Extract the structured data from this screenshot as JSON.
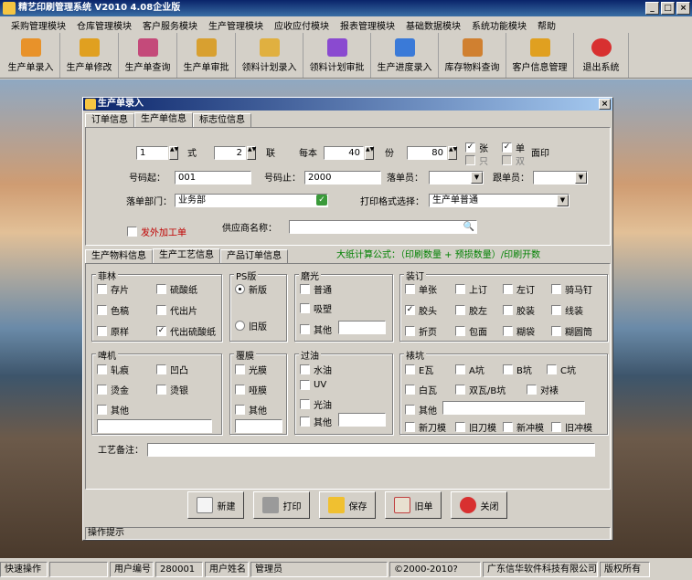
{
  "app": {
    "title": "精艺印刷管理系统   V2010   4.08企业版"
  },
  "menu": [
    "采购管理模块",
    "仓库管理模块",
    "客户服务模块",
    "生产管理模块",
    "应收应付模块",
    "报表管理模块",
    "基础数据模块",
    "系统功能模块",
    "帮助"
  ],
  "toolbar": [
    {
      "label": "生产单录入",
      "icon": "production-entry-icon",
      "color": "#e8922a"
    },
    {
      "label": "生产单修改",
      "icon": "production-edit-icon",
      "color": "#e0a020"
    },
    {
      "label": "生产单查询",
      "icon": "production-query-icon",
      "color": "#c44a7a"
    },
    {
      "label": "生产单审批",
      "icon": "production-approve-icon",
      "color": "#d8a030"
    },
    {
      "label": "领料计划录入",
      "icon": "material-plan-entry-icon",
      "color": "#e0b040"
    },
    {
      "label": "领料计划审批",
      "icon": "material-plan-approve-icon",
      "color": "#8a4ad0"
    },
    {
      "label": "生产进度录入",
      "icon": "progress-entry-icon",
      "color": "#3a7ad8"
    },
    {
      "label": "库存物料查询",
      "icon": "inventory-query-icon",
      "color": "#d08030"
    },
    {
      "label": "客户信息管理",
      "icon": "customer-info-icon",
      "color": "#e0a020"
    },
    {
      "label": "退出系统",
      "icon": "exit-icon",
      "color": "#d83030"
    }
  ],
  "status": {
    "quick_ops": "快速操作",
    "user_no_label": "用户编号",
    "user_no": "280001",
    "user_name_label": "用户姓名",
    "user_name": "管理员",
    "copyright": "©2000-2010?",
    "company": "广东信华软件科技有限公司",
    "rights": "版权所有"
  },
  "child": {
    "title": "生产单录入",
    "tabs": [
      "订单信息",
      "生产单信息",
      "标志位信息"
    ],
    "row1": {
      "v1": "1",
      "l1": "式",
      "v2": "2",
      "l2": "联",
      "l3": "每本",
      "v3": "40",
      "l4": "份",
      "v4": "80",
      "cb_zhang": "张",
      "cb_zhi": "只",
      "cb_dan": "单",
      "cb_shuang": "双",
      "l5": "面印"
    },
    "row2": {
      "start_label": "号码起：",
      "start": "001",
      "end_label": "号码止：",
      "end": "2000",
      "order_person_label": "落单员：",
      "follow_label": "跟单员："
    },
    "row3": {
      "dept_label": "落单部门：",
      "dept": "业务部",
      "print_fmt_label": "打印格式选择：",
      "print_fmt": "生产单普通"
    },
    "row4": {
      "outsource": "发外加工单",
      "supplier_label": "供应商名称："
    },
    "subtabs": [
      "生产物料信息",
      "生产工艺信息",
      "产品订单信息"
    ],
    "formula": "大纸计算公式：（印刷数量 + 预损数量）/印刷开数",
    "groups": {
      "film": {
        "title": "菲林",
        "items": [
          "存片",
          "硫酸纸",
          "色稿",
          "代出片",
          "原样",
          "代出硫酸纸"
        ]
      },
      "ps": {
        "title": "PS版",
        "items": [
          "新版",
          "旧版"
        ]
      },
      "matte": {
        "title": "磨光",
        "items": [
          "普通",
          "吸塑",
          "其他"
        ]
      },
      "bind": {
        "title": "装订",
        "items": [
          "单张",
          "上订",
          "左订",
          "骑马钉",
          "胶头",
          "胶左",
          "胶装",
          "线装",
          "折页",
          "包面",
          "糊袋",
          "糊圆筒"
        ]
      },
      "emboss": {
        "title": "啤机",
        "items": [
          "轧痕",
          "凹凸",
          "烫金",
          "烫银",
          "其他"
        ]
      },
      "laminate": {
        "title": "覆膜",
        "items": [
          "光膜",
          "哑膜",
          "其他"
        ]
      },
      "varnish": {
        "title": "过油",
        "items": [
          "水油",
          "UV",
          "光油",
          "其他"
        ]
      },
      "corr": {
        "title": "裱坑",
        "items": [
          "E瓦",
          "A坑",
          "B坑",
          "C坑",
          "白瓦",
          "双瓦/B坑",
          "对裱",
          "其他",
          "新刀模",
          "旧刀模",
          "新冲模",
          "旧冲模"
        ]
      }
    },
    "remark_label": "工艺备注：",
    "buttons": [
      "新建",
      "打印",
      "保存",
      "旧单",
      "关闭"
    ],
    "hint": "操作提示"
  }
}
